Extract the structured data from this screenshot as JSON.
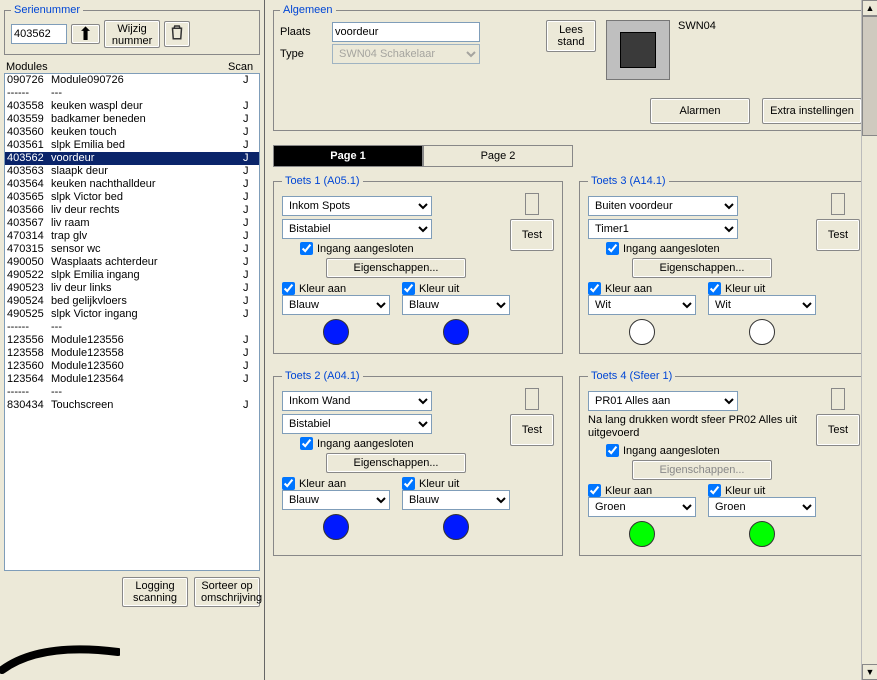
{
  "left": {
    "serienummer_legend": "Serienummer",
    "serienummer_value": "403562",
    "wijzig_nummer": "Wijzig\nnummer",
    "modules_label": "Modules",
    "scan_label": "Scan",
    "logging_scanning": "Logging\nscanning",
    "sorteer": "Sorteer op\nomschrijving",
    "rows": [
      {
        "sn": "090726",
        "desc": "Module090726",
        "scan": "J",
        "sel": false
      },
      {
        "sn": "------",
        "desc": "---",
        "scan": "",
        "sel": false
      },
      {
        "sn": "403558",
        "desc": "keuken waspl deur",
        "scan": "J",
        "sel": false
      },
      {
        "sn": "403559",
        "desc": "badkamer beneden",
        "scan": "J",
        "sel": false
      },
      {
        "sn": "403560",
        "desc": "keuken touch",
        "scan": "J",
        "sel": false
      },
      {
        "sn": "403561",
        "desc": "slpk Emilia bed",
        "scan": "J",
        "sel": false
      },
      {
        "sn": "403562",
        "desc": "voordeur",
        "scan": "J",
        "sel": true
      },
      {
        "sn": "403563",
        "desc": "slaapk deur",
        "scan": "J",
        "sel": false
      },
      {
        "sn": "403564",
        "desc": "keuken nachthalldeur",
        "scan": "J",
        "sel": false
      },
      {
        "sn": "403565",
        "desc": "slpk Victor bed",
        "scan": "J",
        "sel": false
      },
      {
        "sn": "403566",
        "desc": "liv deur rechts",
        "scan": "J",
        "sel": false
      },
      {
        "sn": "403567",
        "desc": "liv raam",
        "scan": "J",
        "sel": false
      },
      {
        "sn": "470314",
        "desc": "trap glv",
        "scan": "J",
        "sel": false
      },
      {
        "sn": "470315",
        "desc": "sensor wc",
        "scan": "J",
        "sel": false
      },
      {
        "sn": "490050",
        "desc": "Wasplaats achterdeur",
        "scan": "J",
        "sel": false
      },
      {
        "sn": "490522",
        "desc": "slpk Emilia ingang",
        "scan": "J",
        "sel": false
      },
      {
        "sn": "490523",
        "desc": "liv deur links",
        "scan": "J",
        "sel": false
      },
      {
        "sn": "490524",
        "desc": "bed gelijkvloers",
        "scan": "J",
        "sel": false
      },
      {
        "sn": "490525",
        "desc": "slpk Victor ingang",
        "scan": "J",
        "sel": false
      },
      {
        "sn": "------",
        "desc": "---",
        "scan": "",
        "sel": false
      },
      {
        "sn": "123556",
        "desc": "Module123556",
        "scan": "J",
        "sel": false
      },
      {
        "sn": "123558",
        "desc": "Module123558",
        "scan": "J",
        "sel": false
      },
      {
        "sn": "123560",
        "desc": "Module123560",
        "scan": "J",
        "sel": false
      },
      {
        "sn": "123564",
        "desc": "Module123564",
        "scan": "J",
        "sel": false
      },
      {
        "sn": "------",
        "desc": "---",
        "scan": "",
        "sel": false
      },
      {
        "sn": "830434",
        "desc": "Touchscreen",
        "scan": "J",
        "sel": false
      }
    ]
  },
  "algemeen": {
    "legend": "Algemeen",
    "plaats_label": "Plaats",
    "plaats_value": "voordeur",
    "type_label": "Type",
    "type_value": "SWN04 Schakelaar",
    "lees_stand": "Lees\nstand",
    "device_name": "SWN04",
    "alarmen": "Alarmen",
    "extra": "Extra instellingen"
  },
  "tabs": {
    "page1": "Page 1",
    "page2": "Page 2"
  },
  "labels": {
    "ingang": "Ingang aangesloten",
    "eigenschappen": "Eigenschappen...",
    "kleur_aan": "Kleur aan",
    "kleur_uit": "Kleur uit",
    "test": "Test"
  },
  "toets": [
    {
      "legend": "Toets 1 (A05.1)",
      "select1": "Inkom Spots",
      "select2": "Bistabiel",
      "ingang": true,
      "eig_enabled": true,
      "kleur_aan_chk": true,
      "kleur_uit_chk": true,
      "kleur_aan": "Blauw",
      "kleur_uit": "Blauw",
      "col_aan": "#0019ff",
      "col_uit": "#0019ff",
      "msg": ""
    },
    {
      "legend": "Toets 3 (A14.1)",
      "select1": "Buiten voordeur",
      "select2": "Timer1",
      "ingang": true,
      "eig_enabled": true,
      "kleur_aan_chk": true,
      "kleur_uit_chk": true,
      "kleur_aan": "Wit",
      "kleur_uit": "Wit",
      "col_aan": "#ffffff",
      "col_uit": "#ffffff",
      "msg": ""
    },
    {
      "legend": "Toets 2 (A04.1)",
      "select1": "Inkom Wand",
      "select2": "Bistabiel",
      "ingang": true,
      "eig_enabled": true,
      "kleur_aan_chk": true,
      "kleur_uit_chk": true,
      "kleur_aan": "Blauw",
      "kleur_uit": "Blauw",
      "col_aan": "#0019ff",
      "col_uit": "#0019ff",
      "msg": ""
    },
    {
      "legend": "Toets 4 (Sfeer 1)",
      "select1": "PR01 Alles aan",
      "select2": "",
      "ingang": true,
      "eig_enabled": false,
      "kleur_aan_chk": true,
      "kleur_uit_chk": true,
      "kleur_aan": "Groen",
      "kleur_uit": "Groen",
      "col_aan": "#00ff00",
      "col_uit": "#00ff00",
      "msg": "Na lang drukken wordt sfeer PR02 Alles uit uitgevoerd"
    }
  ]
}
